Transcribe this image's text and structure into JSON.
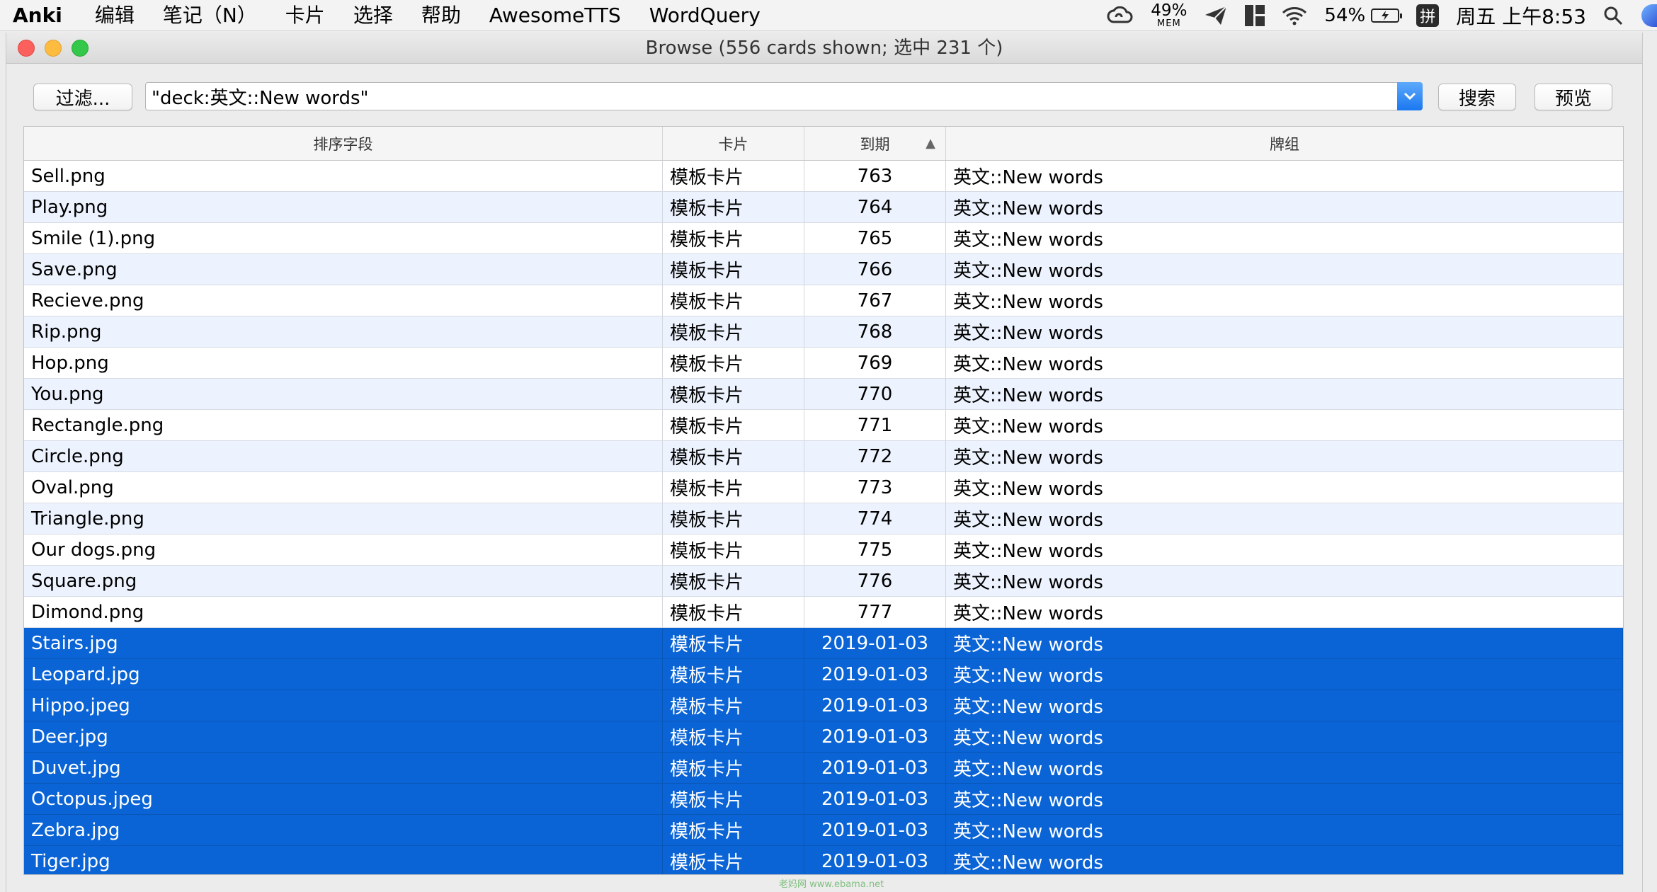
{
  "menubar": {
    "app_name": "Anki",
    "items": [
      "编辑",
      "笔记（N）",
      "卡片",
      "选择",
      "帮助",
      "AwesomeTTS",
      "WordQuery"
    ],
    "status": {
      "mem_percent": "49%",
      "mem_label": "MEM",
      "battery_percent": "54%",
      "input_method": "拼",
      "datetime": "周五 上午8:53"
    }
  },
  "window": {
    "title": "Browse (556 cards shown; 选中 231 个)"
  },
  "toolbar": {
    "filter_label": "过滤...",
    "search_value": "\"deck:英文::New words\"",
    "search_label": "搜索",
    "preview_label": "预览"
  },
  "table": {
    "columns": [
      "排序字段",
      "卡片",
      "到期",
      "牌组"
    ],
    "sort_indicator": "▲",
    "rows": [
      {
        "sort_field": "Sell.png",
        "card": "模板卡片",
        "due": "763",
        "deck": "英文::New words",
        "selected": false
      },
      {
        "sort_field": "Play.png",
        "card": "模板卡片",
        "due": "764",
        "deck": "英文::New words",
        "selected": false
      },
      {
        "sort_field": "Smile (1).png",
        "card": "模板卡片",
        "due": "765",
        "deck": "英文::New words",
        "selected": false
      },
      {
        "sort_field": "Save.png",
        "card": "模板卡片",
        "due": "766",
        "deck": "英文::New words",
        "selected": false
      },
      {
        "sort_field": "Recieve.png",
        "card": "模板卡片",
        "due": "767",
        "deck": "英文::New words",
        "selected": false
      },
      {
        "sort_field": "Rip.png",
        "card": "模板卡片",
        "due": "768",
        "deck": "英文::New words",
        "selected": false
      },
      {
        "sort_field": "Hop.png",
        "card": "模板卡片",
        "due": "769",
        "deck": "英文::New words",
        "selected": false
      },
      {
        "sort_field": "You.png",
        "card": "模板卡片",
        "due": "770",
        "deck": "英文::New words",
        "selected": false
      },
      {
        "sort_field": "Rectangle.png",
        "card": "模板卡片",
        "due": "771",
        "deck": "英文::New words",
        "selected": false
      },
      {
        "sort_field": "Circle.png",
        "card": "模板卡片",
        "due": "772",
        "deck": "英文::New words",
        "selected": false
      },
      {
        "sort_field": "Oval.png",
        "card": "模板卡片",
        "due": "773",
        "deck": "英文::New words",
        "selected": false
      },
      {
        "sort_field": "Triangle.png",
        "card": "模板卡片",
        "due": "774",
        "deck": "英文::New words",
        "selected": false
      },
      {
        "sort_field": "Our dogs.png",
        "card": "模板卡片",
        "due": "775",
        "deck": "英文::New words",
        "selected": false
      },
      {
        "sort_field": "Square.png",
        "card": "模板卡片",
        "due": "776",
        "deck": "英文::New words",
        "selected": false
      },
      {
        "sort_field": "Dimond.png",
        "card": "模板卡片",
        "due": "777",
        "deck": "英文::New words",
        "selected": false
      },
      {
        "sort_field": "Stairs.jpg",
        "card": "模板卡片",
        "due": "2019-01-03",
        "deck": "英文::New words",
        "selected": true
      },
      {
        "sort_field": "Leopard.jpg",
        "card": "模板卡片",
        "due": "2019-01-03",
        "deck": "英文::New words",
        "selected": true
      },
      {
        "sort_field": "Hippo.jpeg",
        "card": "模板卡片",
        "due": "2019-01-03",
        "deck": "英文::New words",
        "selected": true
      },
      {
        "sort_field": "Deer.jpg",
        "card": "模板卡片",
        "due": "2019-01-03",
        "deck": "英文::New words",
        "selected": true
      },
      {
        "sort_field": "Duvet.jpg",
        "card": "模板卡片",
        "due": "2019-01-03",
        "deck": "英文::New words",
        "selected": true
      },
      {
        "sort_field": "Octopus.jpeg",
        "card": "模板卡片",
        "due": "2019-01-03",
        "deck": "英文::New words",
        "selected": true
      },
      {
        "sort_field": "Zebra.jpg",
        "card": "模板卡片",
        "due": "2019-01-03",
        "deck": "英文::New words",
        "selected": true
      },
      {
        "sort_field": "Tiger.jpg",
        "card": "模板卡片",
        "due": "2019-01-03",
        "deck": "英文::New words",
        "selected": true
      }
    ]
  },
  "watermark": "老妈网 www.ebama.net",
  "colors": {
    "selection": "#0a64d6",
    "alt_row": "#edf3fe",
    "dropdown_accent": "#1a78f0"
  }
}
